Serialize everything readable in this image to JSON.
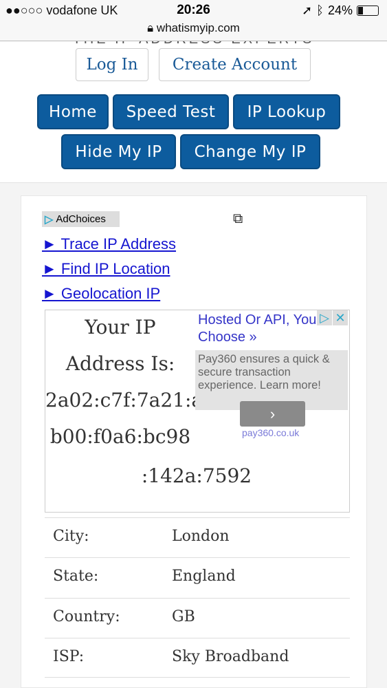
{
  "status_bar": {
    "carrier": "●●○○○ vodafone UK",
    "time": "20:26",
    "battery": "24%",
    "battery_level": 0.24,
    "url": "whatismyip.com"
  },
  "header": {
    "tagline": "THE IP ADDRESS EXPERTS",
    "login": "Log In",
    "create_account": "Create Account"
  },
  "nav": [
    "Home",
    "Speed Test",
    "IP Lookup",
    "Hide My IP",
    "Change My IP"
  ],
  "adchoices": "AdChoices",
  "links": [
    "► Trace IP Address",
    "► Find IP Location",
    "► Geolocation IP"
  ],
  "ip": {
    "label1": "Your IP",
    "label2": "Address Is:",
    "lines": [
      "2a02:c7f:7a21:a",
      "b00:f0a6:bc98",
      ":142a:7592"
    ]
  },
  "ad": {
    "headline": "Hosted Or API, You Choose »",
    "body": "Pay360 ensures a quick & secure transaction experience. Learn more!",
    "button": "›",
    "domain": "pay360.co.uk"
  },
  "details": [
    {
      "label": "City:",
      "value": "London"
    },
    {
      "label": "State:",
      "value": "England"
    },
    {
      "label": "Country:",
      "value": "GB"
    },
    {
      "label": "ISP:",
      "value": "Sky Broadband"
    }
  ]
}
